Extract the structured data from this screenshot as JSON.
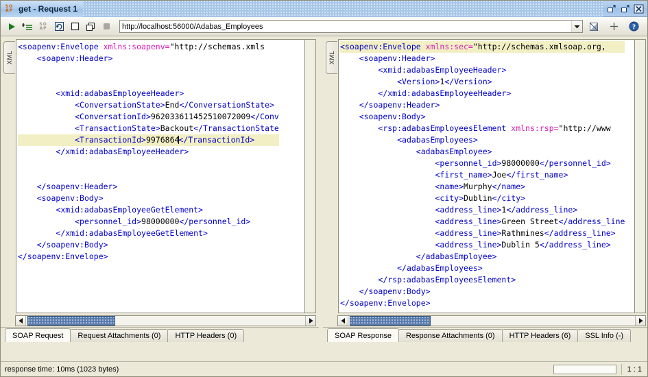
{
  "window": {
    "icon": "soap-icon",
    "title": "get - Request 1",
    "buttons": [
      {
        "name": "restore-window-button",
        "glyph": "restore"
      },
      {
        "name": "maximize-window-button",
        "glyph": "maximize"
      },
      {
        "name": "close-window-button",
        "glyph": "close"
      }
    ]
  },
  "toolbar": {
    "icons": [
      {
        "name": "submit-request-button",
        "glyph": "play"
      },
      {
        "name": "add-assertion-button",
        "glyph": "add-assertion"
      },
      {
        "name": "soap-ws-a-button",
        "glyph": "soap"
      },
      {
        "name": "create-test-request-button",
        "glyph": "recreate"
      },
      {
        "name": "clear-button",
        "glyph": "square"
      },
      {
        "name": "clone-request-button",
        "glyph": "clone"
      },
      {
        "name": "cancel-button",
        "glyph": "stop"
      }
    ],
    "url": {
      "value": "http://localhost:56000/Adabas_Employees",
      "placeholder": "endpoint"
    },
    "right_icons": [
      {
        "name": "filter-icon",
        "glyph": "filter"
      },
      {
        "name": "add-endpoint-icon",
        "glyph": "plus"
      },
      {
        "name": "help-icon",
        "glyph": "question"
      }
    ]
  },
  "request_pane": {
    "vertical_tab": "XML",
    "lines": [
      {
        "indent": 0,
        "hl": false,
        "parts": [
          {
            "c": "tag",
            "t": "<soapenv:Envelope "
          },
          {
            "c": "attr",
            "t": "xmlns:soapenv="
          },
          {
            "c": "val",
            "t": "\"http://schemas.xmls"
          }
        ]
      },
      {
        "indent": 1,
        "hl": false,
        "parts": [
          {
            "c": "tag",
            "t": "<soapenv:Header>"
          }
        ]
      },
      {
        "indent": 0,
        "hl": false,
        "parts": [
          {
            "c": "txt",
            "t": ""
          }
        ]
      },
      {
        "indent": 0,
        "hl": false,
        "parts": [
          {
            "c": "txt",
            "t": ""
          }
        ]
      },
      {
        "indent": 2,
        "hl": false,
        "parts": [
          {
            "c": "tag",
            "t": "<xmid:adabasEmployeeHeader>"
          }
        ]
      },
      {
        "indent": 3,
        "hl": false,
        "parts": [
          {
            "c": "tag",
            "t": "<ConversationState>"
          },
          {
            "c": "txt",
            "t": "End"
          },
          {
            "c": "tag",
            "t": "</ConversationState>"
          }
        ]
      },
      {
        "indent": 3,
        "hl": false,
        "parts": [
          {
            "c": "tag",
            "t": "<ConversationId>"
          },
          {
            "c": "txt",
            "t": "962033611452510072009"
          },
          {
            "c": "tag",
            "t": "</Conv"
          }
        ]
      },
      {
        "indent": 3,
        "hl": false,
        "parts": [
          {
            "c": "tag",
            "t": "<TransactionState>"
          },
          {
            "c": "txt",
            "t": "Backout"
          },
          {
            "c": "tag",
            "t": "</TransactionState"
          }
        ]
      },
      {
        "indent": 3,
        "hl": true,
        "caret_after": 2,
        "parts": [
          {
            "c": "tag",
            "t": "<TransactionId>"
          },
          {
            "c": "txt",
            "t": "9976864"
          },
          {
            "c": "tag",
            "t": "</TransactionId>"
          }
        ]
      },
      {
        "indent": 2,
        "hl": false,
        "parts": [
          {
            "c": "tag",
            "t": "</xmid:adabasEmployeeHeader>"
          }
        ]
      },
      {
        "indent": 0,
        "hl": false,
        "parts": [
          {
            "c": "txt",
            "t": ""
          }
        ]
      },
      {
        "indent": 0,
        "hl": false,
        "parts": [
          {
            "c": "txt",
            "t": ""
          }
        ]
      },
      {
        "indent": 1,
        "hl": false,
        "parts": [
          {
            "c": "tag",
            "t": "</soapenv:Header>"
          }
        ]
      },
      {
        "indent": 1,
        "hl": false,
        "parts": [
          {
            "c": "tag",
            "t": "<soapenv:Body>"
          }
        ]
      },
      {
        "indent": 2,
        "hl": false,
        "parts": [
          {
            "c": "tag",
            "t": "<xmid:adabasEmployeeGetElement>"
          }
        ]
      },
      {
        "indent": 3,
        "hl": false,
        "parts": [
          {
            "c": "tag",
            "t": "<personnel_id>"
          },
          {
            "c": "txt",
            "t": "98000000"
          },
          {
            "c": "tag",
            "t": "</personnel_id>"
          }
        ]
      },
      {
        "indent": 2,
        "hl": false,
        "parts": [
          {
            "c": "tag",
            "t": "</xmid:adabasEmployeeGetElement>"
          }
        ]
      },
      {
        "indent": 1,
        "hl": false,
        "parts": [
          {
            "c": "tag",
            "t": "</soapenv:Body>"
          }
        ]
      },
      {
        "indent": 0,
        "hl": false,
        "parts": [
          {
            "c": "tag",
            "t": "</soapenv:Envelope>"
          }
        ]
      }
    ],
    "tabs": [
      {
        "label": "SOAP Request",
        "active": true
      },
      {
        "label": "Request Attachments (0)",
        "active": false
      },
      {
        "label": "HTTP Headers (0)",
        "active": false
      }
    ]
  },
  "response_pane": {
    "vertical_tab": "XML",
    "lines": [
      {
        "indent": 0,
        "hl": true,
        "parts": [
          {
            "c": "tag",
            "t": "<soapenv:Envelope "
          },
          {
            "c": "attr",
            "t": "xmlns:sec="
          },
          {
            "c": "val",
            "t": "\"http://schemas.xmlsoap.org,"
          }
        ]
      },
      {
        "indent": 1,
        "hl": false,
        "parts": [
          {
            "c": "tag",
            "t": "<soapenv:Header>"
          }
        ]
      },
      {
        "indent": 2,
        "hl": false,
        "parts": [
          {
            "c": "tag",
            "t": "<xmid:adabasEmployeeHeader>"
          }
        ]
      },
      {
        "indent": 3,
        "hl": false,
        "parts": [
          {
            "c": "tag",
            "t": "<Version>"
          },
          {
            "c": "txt",
            "t": "1"
          },
          {
            "c": "tag",
            "t": "</Version>"
          }
        ]
      },
      {
        "indent": 2,
        "hl": false,
        "parts": [
          {
            "c": "tag",
            "t": "</xmid:adabasEmployeeHeader>"
          }
        ]
      },
      {
        "indent": 1,
        "hl": false,
        "parts": [
          {
            "c": "tag",
            "t": "</soapenv:Header>"
          }
        ]
      },
      {
        "indent": 1,
        "hl": false,
        "parts": [
          {
            "c": "tag",
            "t": "<soapenv:Body>"
          }
        ]
      },
      {
        "indent": 2,
        "hl": false,
        "parts": [
          {
            "c": "tag",
            "t": "<rsp:adabasEmployeesElement "
          },
          {
            "c": "attr",
            "t": "xmlns:rsp="
          },
          {
            "c": "val",
            "t": "\"http://www"
          }
        ]
      },
      {
        "indent": 3,
        "hl": false,
        "parts": [
          {
            "c": "tag",
            "t": "<adabasEmployees>"
          }
        ]
      },
      {
        "indent": 4,
        "hl": false,
        "parts": [
          {
            "c": "tag",
            "t": "<adabasEmployee>"
          }
        ]
      },
      {
        "indent": 5,
        "hl": false,
        "parts": [
          {
            "c": "tag",
            "t": "<personnel_id>"
          },
          {
            "c": "txt",
            "t": "98000000"
          },
          {
            "c": "tag",
            "t": "</personnel_id>"
          }
        ]
      },
      {
        "indent": 5,
        "hl": false,
        "parts": [
          {
            "c": "tag",
            "t": "<first_name>"
          },
          {
            "c": "txt",
            "t": "Joe"
          },
          {
            "c": "tag",
            "t": "</first_name>"
          }
        ]
      },
      {
        "indent": 5,
        "hl": false,
        "parts": [
          {
            "c": "tag",
            "t": "<name>"
          },
          {
            "c": "txt",
            "t": "Murphy"
          },
          {
            "c": "tag",
            "t": "</name>"
          }
        ]
      },
      {
        "indent": 5,
        "hl": false,
        "parts": [
          {
            "c": "tag",
            "t": "<city>"
          },
          {
            "c": "txt",
            "t": "Dublin"
          },
          {
            "c": "tag",
            "t": "</city>"
          }
        ]
      },
      {
        "indent": 5,
        "hl": false,
        "parts": [
          {
            "c": "tag",
            "t": "<address_line>"
          },
          {
            "c": "txt",
            "t": "1"
          },
          {
            "c": "tag",
            "t": "</address_line>"
          }
        ]
      },
      {
        "indent": 5,
        "hl": false,
        "parts": [
          {
            "c": "tag",
            "t": "<address_line>"
          },
          {
            "c": "txt",
            "t": "Green Street"
          },
          {
            "c": "tag",
            "t": "</address_line"
          }
        ]
      },
      {
        "indent": 5,
        "hl": false,
        "parts": [
          {
            "c": "tag",
            "t": "<address_line>"
          },
          {
            "c": "txt",
            "t": "Rathmines"
          },
          {
            "c": "tag",
            "t": "</address_line>"
          }
        ]
      },
      {
        "indent": 5,
        "hl": false,
        "parts": [
          {
            "c": "tag",
            "t": "<address_line>"
          },
          {
            "c": "txt",
            "t": "Dublin 5"
          },
          {
            "c": "tag",
            "t": "</address_line>"
          }
        ]
      },
      {
        "indent": 4,
        "hl": false,
        "parts": [
          {
            "c": "tag",
            "t": "</adabasEmployee>"
          }
        ]
      },
      {
        "indent": 3,
        "hl": false,
        "parts": [
          {
            "c": "tag",
            "t": "</adabasEmployees>"
          }
        ]
      },
      {
        "indent": 2,
        "hl": false,
        "parts": [
          {
            "c": "tag",
            "t": "</rsp:adabasEmployeesElement>"
          }
        ]
      },
      {
        "indent": 1,
        "hl": false,
        "parts": [
          {
            "c": "tag",
            "t": "</soapenv:Body>"
          }
        ]
      },
      {
        "indent": 0,
        "hl": false,
        "parts": [
          {
            "c": "tag",
            "t": "</soapenv:Envelope>"
          }
        ]
      }
    ],
    "tabs": [
      {
        "label": "SOAP Response",
        "active": true
      },
      {
        "label": "Response Attachments (0)",
        "active": false
      },
      {
        "label": "HTTP Headers (6)",
        "active": false
      },
      {
        "label": "SSL Info (-)",
        "active": false
      }
    ]
  },
  "statusbar": {
    "message": "response time: 10ms (1023 bytes)",
    "ratio": "1 : 1"
  },
  "colors": {
    "tag": "#0000cc",
    "attr": "#d918b4",
    "highlight": "#f2efc4",
    "title_accent": "#9cc0e6",
    "scroll_thumb": "#5a7dae"
  }
}
